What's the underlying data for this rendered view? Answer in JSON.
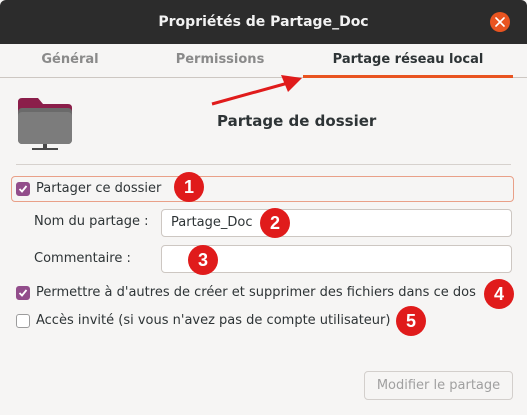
{
  "window": {
    "title": "Propriétés de Partage_Doc"
  },
  "tabs": [
    {
      "label": "Général",
      "active": false
    },
    {
      "label": "Permissions",
      "active": false
    },
    {
      "label": "Partage réseau local",
      "active": true
    }
  ],
  "main": {
    "heading": "Partage de dossier",
    "share_checkbox": {
      "label": "Partager ce dossier",
      "checked": true
    },
    "share_name": {
      "label": "Nom du partage :",
      "value": "Partage_Doc"
    },
    "comment": {
      "label": "Commentaire :",
      "value": ""
    },
    "allow_others": {
      "label": "Permettre à d'autres de créer et supprimer des fichiers dans ce dos",
      "checked": true
    },
    "guest_access": {
      "label": "Accès invité (si vous n'avez pas de compte utilisateur)",
      "checked": false
    },
    "modify_button": {
      "label": "Modifier le partage",
      "enabled": false
    }
  },
  "annotations": [
    "1",
    "2",
    "3",
    "4",
    "5"
  ],
  "colors": {
    "accent": "#e95420",
    "check": "#924d8b",
    "annotation": "#e01b1b",
    "titlebar": "#2c2c2c"
  },
  "icons": {
    "folder": "folder-share-icon",
    "close": "close-icon"
  }
}
